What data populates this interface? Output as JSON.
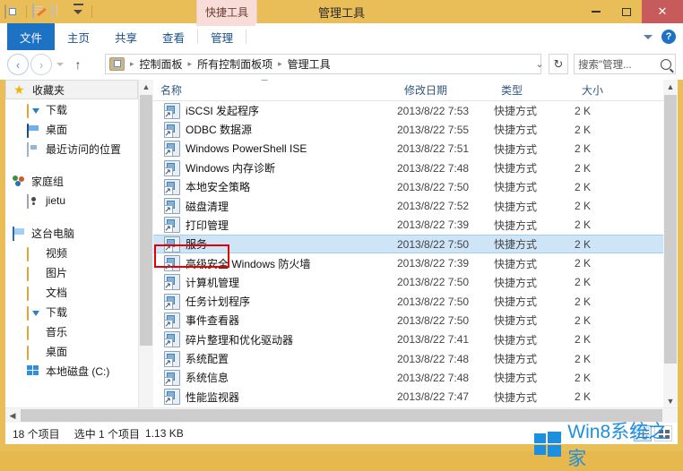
{
  "window": {
    "title": "管理工具",
    "contextual_tab": "快捷工具",
    "minimize": "—",
    "maximize": "□",
    "close": "✕"
  },
  "quick_access": {
    "items": [
      {
        "name": "folder-properties-icon"
      },
      {
        "name": "new-item-icon"
      },
      {
        "name": "properties-icon"
      },
      {
        "name": "customize-dropdown-icon"
      }
    ]
  },
  "ribbon": {
    "tabs": [
      {
        "label": "文件",
        "active": true
      },
      {
        "label": "主页",
        "active": false
      },
      {
        "label": "共享",
        "active": false
      },
      {
        "label": "查看",
        "active": false
      },
      {
        "label": "管理",
        "active": false
      }
    ],
    "collapse_icon": "chevron-down-icon",
    "help_label": "?"
  },
  "address_bar": {
    "back": "‹",
    "forward": "›",
    "history_dropdown": "▾",
    "up": "↑",
    "breadcrumb": [
      "控制面板",
      "所有控制面板项",
      "管理工具"
    ],
    "breadcrumb_separator": "▸",
    "dropdown": "⌄",
    "refresh": "↻"
  },
  "search": {
    "placeholder": "搜索\"管理...",
    "icon": "search-icon"
  },
  "sidebar": {
    "groups": [
      {
        "header": {
          "label": "收藏夹",
          "icon": "star-icon",
          "selected": true
        },
        "items": [
          {
            "label": "下载",
            "icon": "download-folder-icon"
          },
          {
            "label": "桌面",
            "icon": "desktop-icon"
          },
          {
            "label": "最近访问的位置",
            "icon": "recent-places-icon"
          }
        ]
      },
      {
        "header": {
          "label": "家庭组",
          "icon": "homegroup-icon",
          "selected": false
        },
        "items": [
          {
            "label": "jietu",
            "icon": "user-icon"
          }
        ]
      },
      {
        "header": {
          "label": "这台电脑",
          "icon": "computer-icon",
          "selected": false
        },
        "items": [
          {
            "label": "视频",
            "icon": "videos-folder-icon"
          },
          {
            "label": "图片",
            "icon": "pictures-folder-icon"
          },
          {
            "label": "文档",
            "icon": "documents-folder-icon"
          },
          {
            "label": "下载",
            "icon": "download-folder-icon"
          },
          {
            "label": "音乐",
            "icon": "music-folder-icon"
          },
          {
            "label": "桌面",
            "icon": "desktop-folder-icon"
          },
          {
            "label": "本地磁盘 (C:)",
            "icon": "local-disk-icon"
          }
        ]
      }
    ]
  },
  "filelist": {
    "columns": [
      {
        "label": "名称",
        "sorted": true
      },
      {
        "label": "修改日期",
        "sorted": false
      },
      {
        "label": "类型",
        "sorted": false
      },
      {
        "label": "大小",
        "sorted": false
      }
    ],
    "rows": [
      {
        "name": "iSCSI 发起程序",
        "date": "2013/8/22 7:53",
        "type": "快捷方式",
        "size": "2 K",
        "selected": false
      },
      {
        "name": "ODBC 数据源",
        "date": "2013/8/22 7:55",
        "type": "快捷方式",
        "size": "2 K",
        "selected": false
      },
      {
        "name": "Windows PowerShell ISE",
        "date": "2013/8/22 7:51",
        "type": "快捷方式",
        "size": "2 K",
        "selected": false
      },
      {
        "name": "Windows 内存诊断",
        "date": "2013/8/22 7:48",
        "type": "快捷方式",
        "size": "2 K",
        "selected": false
      },
      {
        "name": "本地安全策略",
        "date": "2013/8/22 7:50",
        "type": "快捷方式",
        "size": "2 K",
        "selected": false
      },
      {
        "name": "磁盘清理",
        "date": "2013/8/22 7:52",
        "type": "快捷方式",
        "size": "2 K",
        "selected": false
      },
      {
        "name": "打印管理",
        "date": "2013/8/22 7:39",
        "type": "快捷方式",
        "size": "2 K",
        "selected": false
      },
      {
        "name": "服务",
        "date": "2013/8/22 7:50",
        "type": "快捷方式",
        "size": "2 K",
        "selected": true
      },
      {
        "name": "高级安全 Windows 防火墙",
        "date": "2013/8/22 7:39",
        "type": "快捷方式",
        "size": "2 K",
        "selected": false
      },
      {
        "name": "计算机管理",
        "date": "2013/8/22 7:50",
        "type": "快捷方式",
        "size": "2 K",
        "selected": false
      },
      {
        "name": "任务计划程序",
        "date": "2013/8/22 7:50",
        "type": "快捷方式",
        "size": "2 K",
        "selected": false
      },
      {
        "name": "事件查看器",
        "date": "2013/8/22 7:50",
        "type": "快捷方式",
        "size": "2 K",
        "selected": false
      },
      {
        "name": "碎片整理和优化驱动器",
        "date": "2013/8/22 7:41",
        "type": "快捷方式",
        "size": "2 K",
        "selected": false
      },
      {
        "name": "系统配置",
        "date": "2013/8/22 7:48",
        "type": "快捷方式",
        "size": "2 K",
        "selected": false
      },
      {
        "name": "系统信息",
        "date": "2013/8/22 7:48",
        "type": "快捷方式",
        "size": "2 K",
        "selected": false
      },
      {
        "name": "性能监视器",
        "date": "2013/8/22 7:47",
        "type": "快捷方式",
        "size": "2 K",
        "selected": false
      }
    ]
  },
  "status_bar": {
    "item_count": "18 个项目",
    "selection": "选中 1 个项目",
    "selection_size": "1.13 KB"
  },
  "watermark": {
    "text": "Win8系统之家",
    "logo": "windows-logo-icon"
  },
  "colors": {
    "window_frame": "#e9bd57",
    "active_tab": "#1d72c4",
    "contextual_tab": "#f8dcd7",
    "close_button": "#c75b5b",
    "selection": "#cde5f7",
    "annotation": "#e60000",
    "watermark": "#1d8fe0"
  }
}
